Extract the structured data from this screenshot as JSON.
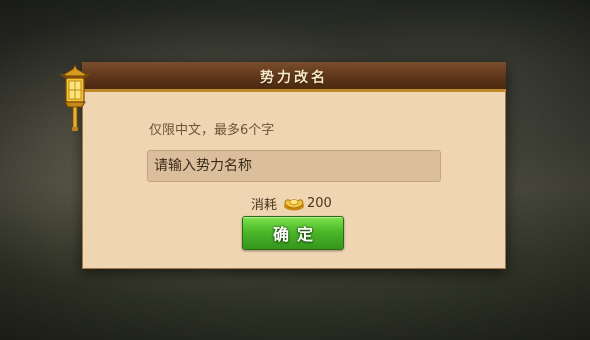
{
  "dialog": {
    "title": "势力改名",
    "hint": "仅限中文，最多6个字",
    "input_placeholder": "请输入势力名称",
    "cost_label": "消耗",
    "cost_amount": "200",
    "cost_icon": "gold-ingot-icon",
    "confirm_label": "确定"
  },
  "colors": {
    "title_bar": "#5e3618",
    "panel": "#efd5b1",
    "confirm_button": "#4cb82a"
  }
}
